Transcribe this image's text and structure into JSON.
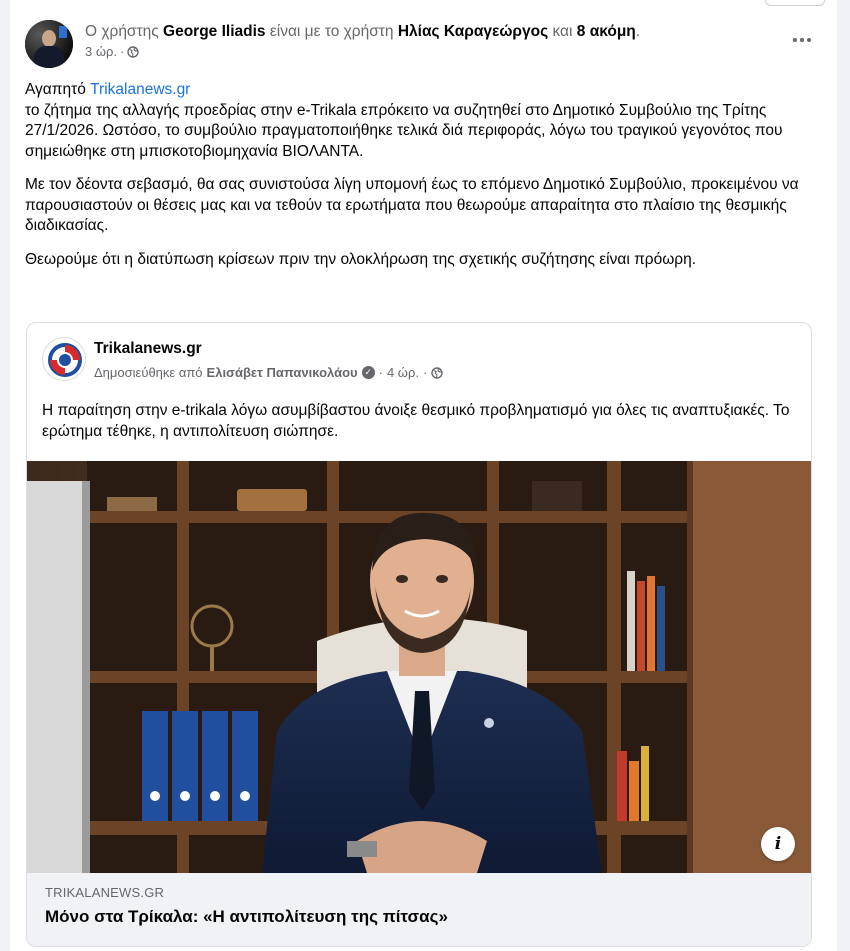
{
  "post": {
    "author_prefix": "Ο χρήστης",
    "author_name": "George Iliadis",
    "with_text": "είναι με το χρήστη",
    "tagged_name": "Ηλίας Καραγεώργος",
    "and_text": "και",
    "others": "8 ακόμη",
    "end_dot": ".",
    "time": "3 ώρ.",
    "separator": "·",
    "greeting": "Αγαπητό",
    "greeting_link": "Trikalanews.gr",
    "paragraph1": "το ζήτημα της αλλαγής προεδρίας στην e-Trikala επρόκειτο να συζητηθεί στο Δημοτικό Συμβούλιο της Τρίτης 27/1/2026. Ωστόσο, το συμβούλιο πραγματοποιήθηκε τελικά διά περιφοράς, λόγω του τραγικού γεγονότος που σημειώθηκε στη μπισκοτοβιομηχανία ΒΙΟΛΑΝΤΑ.",
    "paragraph2": "Με τον δέοντα σεβασμό, θα σας συνιστούσα λίγη υπομονή έως το επόμενο Δημοτικό Συμβούλιο, προκειμένου να παρουσιαστούν οι θέσεις μας και να τεθούν τα ερωτήματα που θεωρούμε απαραίτητα στο πλαίσιο της θεσμικής διαδικασίας.",
    "paragraph3": "Θεωρούμε ότι η διατύπωση κρίσεων πριν την ολοκλήρωση της σχετικής συζήτησης είναι πρόωρη."
  },
  "shared": {
    "page_name": "Trikalanews.gr",
    "published_by": "Δημοσιεύθηκε από",
    "publisher": "Ελισάβετ Παπανικολάου",
    "time": "4 ώρ.",
    "separator": "·",
    "text": "Η παραίτηση στην e-trikala λόγω ασυμβίβαστου άνοιξε θεσμικό προβληματισμό για όλες τις αναπτυξιακές. Το ερώτημα τέθηκε, η αντιπολίτευση σιώπησε.",
    "link_domain": "TRIKALANEWS.GR",
    "link_title": "Μόνο στα Τρίκαλα: «Η αντιπολίτευση της πίτσας»"
  },
  "icons": {
    "more": "more-horizontal-icon",
    "globe": "globe-icon",
    "info": "info-icon",
    "verified": "verified-icon"
  },
  "colors": {
    "link": "#1b74e4",
    "muted": "#65676b",
    "footer_bg": "#f0f2f5"
  }
}
